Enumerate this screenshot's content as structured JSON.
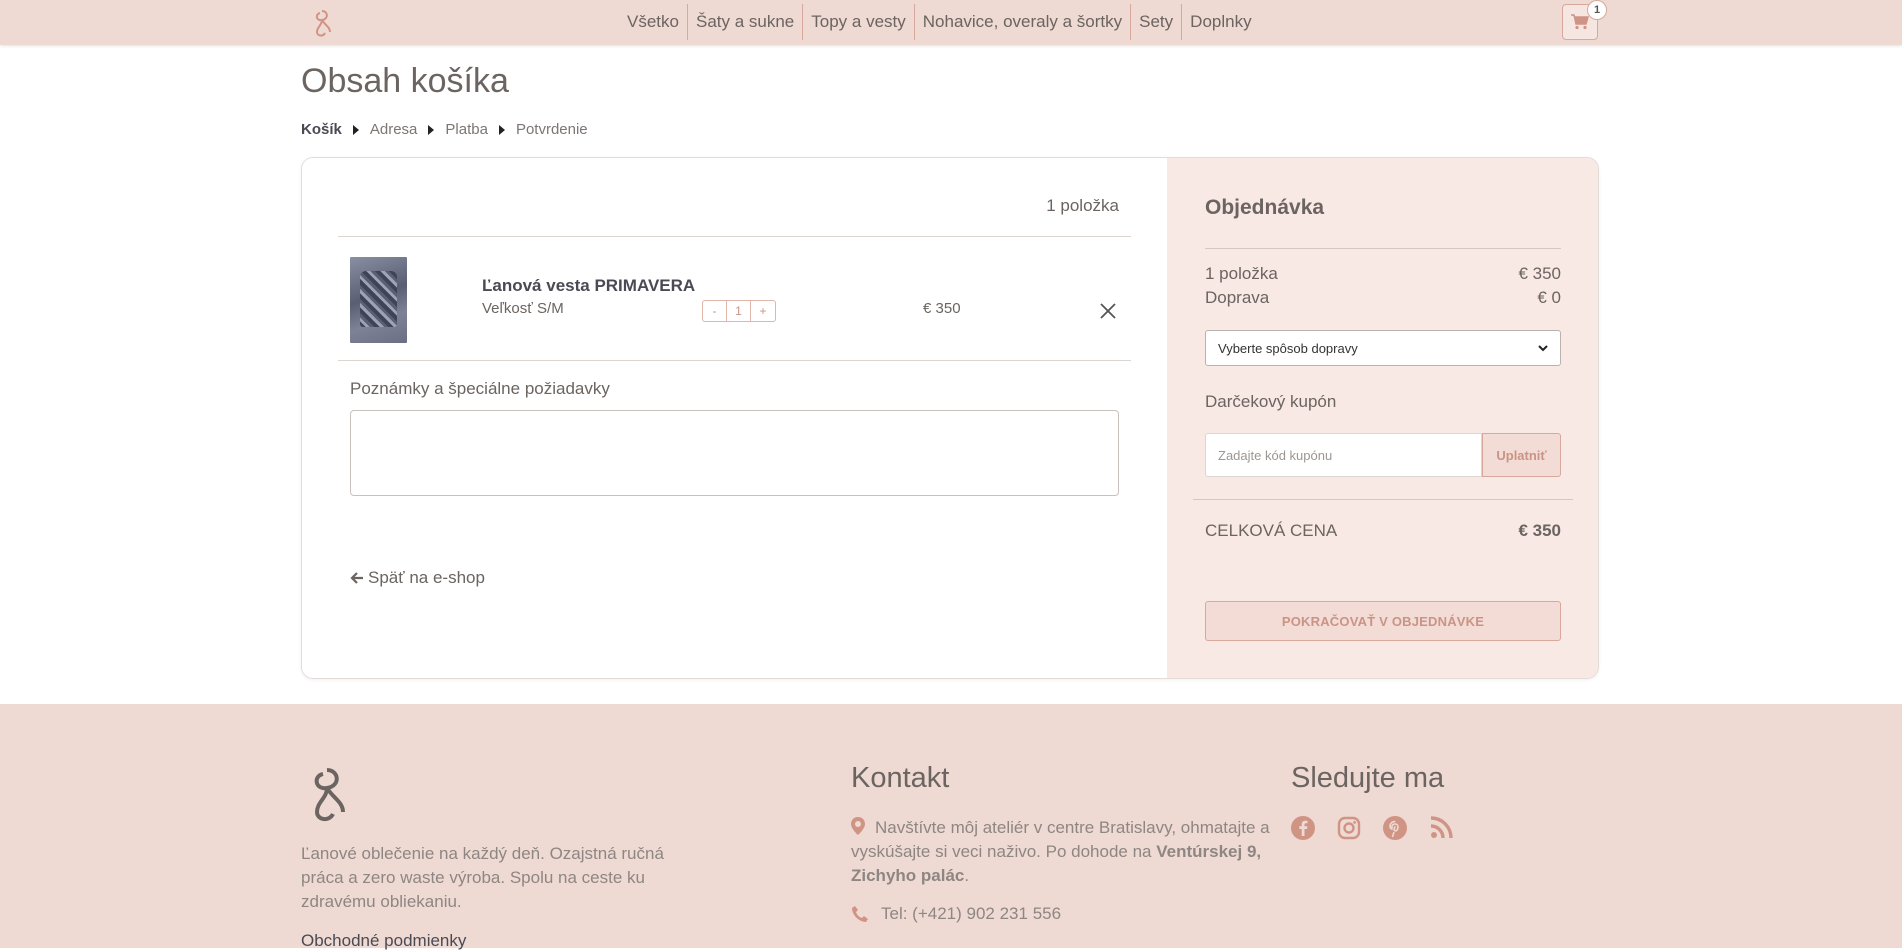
{
  "header": {
    "nav": [
      "Všetko",
      "Šaty a sukne",
      "Topy a vesty",
      "Nohavice, overaly a šortky",
      "Sety",
      "Doplnky"
    ],
    "cart_count": "1"
  },
  "page": {
    "title": "Obsah košíka",
    "breadcrumb": [
      "Košík",
      "Adresa",
      "Platba",
      "Potvrdenie"
    ]
  },
  "cart": {
    "item_count": "1 položka",
    "item": {
      "name": "Ľanová vesta PRIMAVERA",
      "size": "Veľkosť S/M",
      "qty_minus": "-",
      "qty": "1",
      "qty_plus": "+",
      "price": "€ 350"
    },
    "notes_label": "Poznámky a špeciálne požiadavky",
    "back_link": "Späť na e-shop"
  },
  "summary": {
    "title": "Objednávka",
    "items_label": "1 položka",
    "items_value": "€ 350",
    "shipping_label": "Doprava",
    "shipping_value": "€ 0",
    "shipping_select": "Vyberte spôsob dopravy",
    "coupon_label": "Darčekový kupón",
    "coupon_placeholder": "Zadajte kód kupónu",
    "coupon_button": "Uplatniť",
    "total_label": "CELKOVÁ CENA",
    "total_value": "€ 350",
    "checkout_button": "POKRAČOVAŤ V OBJEDNÁVKE"
  },
  "footer": {
    "description": "Ľanové oblečenie na každý deň. Ozajstná ručná práca a zero waste výroba. Spolu na ceste ku zdravému obliekaniu.",
    "terms_link": "Obchodné podmienky",
    "contact_title": "Kontakt",
    "contact_text": "Navštívte môj ateliér v centre Bratislavy, ohmatajte a vyskúšajte si veci naživo. Po dohode na",
    "contact_address": "Ventúrskej 9, Zichyho palác",
    "contact_phone": "Tel: (+421) 902 231 556",
    "follow_title": "Sledujte ma"
  },
  "colors": {
    "accent": "#efd9d3",
    "button_text": "#c99486",
    "icon": "#d09484"
  }
}
